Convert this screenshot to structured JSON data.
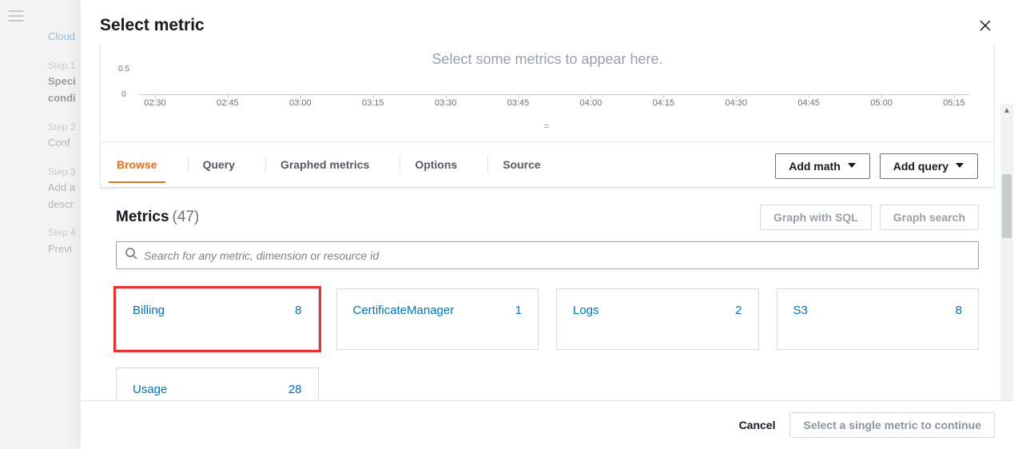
{
  "background": {
    "breadcrumb": "Cloud",
    "steps": [
      {
        "label": "Step 1",
        "title1": "Speci",
        "title2": "condi"
      },
      {
        "label": "Step 2",
        "title1": "Conf"
      },
      {
        "label": "Step 3",
        "title1": "Add a",
        "title2": "descr"
      },
      {
        "label": "Step 4",
        "title1": "Previ"
      }
    ]
  },
  "modal": {
    "title": "Select metric",
    "chart": {
      "placeholder": "Select some metrics to appear here.",
      "y_half": "0.5",
      "y_zero": "0",
      "ticks": [
        "02:30",
        "02:45",
        "03:00",
        "03:15",
        "03:30",
        "03:45",
        "04:00",
        "04:15",
        "04:30",
        "04:45",
        "05:00",
        "05:15"
      ],
      "handle": "="
    },
    "tabs": [
      "Browse",
      "Query",
      "Graphed metrics",
      "Options",
      "Source"
    ],
    "actions": {
      "add_math": "Add math",
      "add_query": "Add query"
    },
    "metrics": {
      "title": "Metrics",
      "count": "(47)",
      "graph_sql": "Graph with SQL",
      "graph_search": "Graph search",
      "search_placeholder": "Search for any metric, dimension or resource id",
      "cards": [
        {
          "name": "Billing",
          "count": "8",
          "highlight": true
        },
        {
          "name": "CertificateManager",
          "count": "1"
        },
        {
          "name": "Logs",
          "count": "2"
        },
        {
          "name": "S3",
          "count": "8"
        },
        {
          "name": "Usage",
          "count": "28"
        }
      ]
    },
    "footer": {
      "cancel": "Cancel",
      "select": "Select a single metric to continue"
    }
  },
  "chart_data": {
    "type": "line",
    "title": "Select some metrics to appear here.",
    "x": [
      "02:30",
      "02:45",
      "03:00",
      "03:15",
      "03:30",
      "03:45",
      "04:00",
      "04:15",
      "04:30",
      "04:45",
      "05:00",
      "05:15"
    ],
    "series": [],
    "ylim": [
      0,
      0.5
    ],
    "xlabel": "",
    "ylabel": ""
  }
}
